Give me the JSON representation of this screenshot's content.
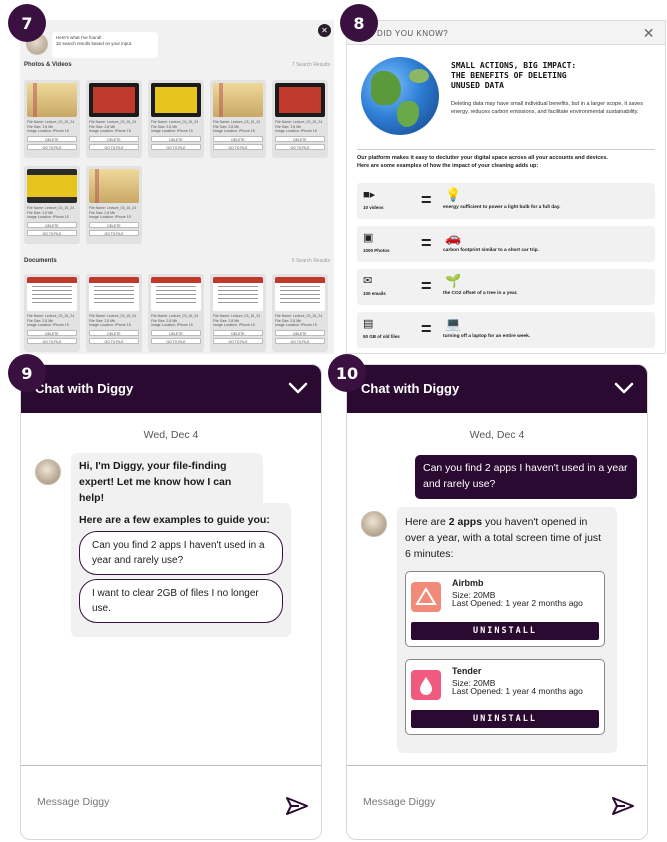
{
  "badges": {
    "b7": "7",
    "b8": "8",
    "b9": "9",
    "b10": "10"
  },
  "search_panel": {
    "message_line1": "Here's what I've found!",
    "message_line2": "32 search results based on your input.",
    "photos_title": "Photos & Videos",
    "photos_count": "7 Search Results",
    "documents_title": "Documents",
    "documents_count": "5 Search Results",
    "photo_cards": [
      {
        "thumb": "notes",
        "name": "File Name: Lecture_03_15_24",
        "size": "File Size: 2.8 Mb",
        "loc": "Image Location: iPhone 15",
        "b1": "DELETE",
        "b2": "GO TO FILE"
      },
      {
        "thumb": "screen red",
        "name": "File Name: Lecture_03_15_24",
        "size": "File Size: 2.8 Mb",
        "loc": "Image Location: iPhone 15",
        "b1": "DELETE",
        "b2": "GO TO FILE"
      },
      {
        "thumb": "screen yellow",
        "name": "File Name: Lecture_03_15_24",
        "size": "File Size: 2.8 Mb",
        "loc": "Image Location: iPhone 15",
        "b1": "DELETE",
        "b2": "GO TO FILE"
      },
      {
        "thumb": "notes",
        "name": "File Name: Lecture_03_15_24",
        "size": "File Size: 2.8 Mb",
        "loc": "Image Location: iPhone 15",
        "b1": "DELETE",
        "b2": "GO TO FILE"
      },
      {
        "thumb": "screen red",
        "name": "File Name: Lecture_03_15_24",
        "size": "File Size: 2.8 Mb",
        "loc": "Image Location: iPhone 15",
        "b1": "DELETE",
        "b2": "GO TO FILE"
      },
      {
        "thumb": "yellowbig",
        "name": "File Name: Lecture_03_15_24",
        "size": "File Size: 2.8 Mb",
        "loc": "Image Location: iPhone 15",
        "b1": "DELETE",
        "b2": "GO TO FILE"
      },
      {
        "thumb": "notes",
        "name": "File Name: Lecture_03_15_24",
        "size": "File Size: 2.8 Mb",
        "loc": "Image Location: iPhone 15",
        "b1": "DELETE",
        "b2": "GO TO FILE"
      }
    ],
    "doc_cards": [
      {
        "thumb": "doc",
        "name": "File Name: Lecture_03_15_24",
        "size": "File Size: 2.8 Mb",
        "loc": "Image Location: iPhone 15",
        "b1": "DELETE",
        "b2": "GO TO FILE"
      },
      {
        "thumb": "doc",
        "name": "File Name: Lecture_03_15_24",
        "size": "File Size: 2.8 Mb",
        "loc": "Image Location: iPhone 15",
        "b1": "DELETE",
        "b2": "GO TO FILE"
      },
      {
        "thumb": "doc",
        "name": "File Name: Lecture_03_15_24",
        "size": "File Size: 2.8 Mb",
        "loc": "Image Location: iPhone 15",
        "b1": "DELETE",
        "b2": "GO TO FILE"
      },
      {
        "thumb": "doc",
        "name": "File Name: Lecture_03_15_24",
        "size": "File Size: 2.8 Mb",
        "loc": "Image Location: iPhone 15",
        "b1": "DELETE",
        "b2": "GO TO FILE"
      },
      {
        "thumb": "doc",
        "name": "File Name: Lecture_03_15_24",
        "size": "File Size: 2.8 Mb",
        "loc": "Image Location: iPhone 15",
        "b1": "DELETE",
        "b2": "GO TO FILE"
      }
    ]
  },
  "did_you_know": {
    "header": "DID YOU KNOW?",
    "title_line1": "SMALL ACTIONS, BIG IMPACT:",
    "title_line2": "THE BENEFITS OF DELETING",
    "title_line3": "UNUSED DATA",
    "body": "Deleting data may have small individual benefits, but in a larger scope, it saves energy, reduces carbon emissions, and facilitate environmental sustainability.",
    "intro_line1": "Our platform makes it easy to declutter your digital space across all your accounts and devices.",
    "intro_line2": "Here are some examples of how the impact of your cleaning adds up:",
    "rows": [
      {
        "icon": "video-camera-icon",
        "label": "10 videos",
        "result_icon": "light-bulb-icon",
        "result": "energy sufficient to power a light bulb for a full day."
      },
      {
        "icon": "photo-icon",
        "label": "1000 Photos",
        "result_icon": "car-icon",
        "result": "carbon footprint similar to a short car trip."
      },
      {
        "icon": "envelope-icon",
        "label": "100 emails",
        "result_icon": "plant-icon",
        "result": "the CO2 offset of a tree in a year."
      },
      {
        "icon": "file-icon",
        "label": "50 GB of old files",
        "result_icon": "laptop-icon",
        "result": "turning off a laptop for an entire week."
      }
    ],
    "equals": "="
  },
  "chat_left": {
    "title": "Chat with Diggy",
    "date": "Wed, Dec 4",
    "greeting": "Hi, I'm Diggy, your file-finding expert! Let me know how I can help!",
    "examples_title": "Here are a few examples to guide you:",
    "example1": "Can you find 2 apps I haven't used in a year and rarely use?",
    "example2": "I want to clear 2GB of files I no longer use.",
    "input_placeholder": "Message Diggy"
  },
  "chat_right": {
    "title": "Chat with Diggy",
    "date": "Wed, Dec 4",
    "user_message": "Can you find 2 apps I haven't used in a year and rarely use?",
    "reply_pre": "Here are ",
    "reply_bold": "2 apps",
    "reply_post": " you haven't opened in over a year, with a total screen time of just 6 minutes:",
    "apps": [
      {
        "name": "Airbmb",
        "size": "Size: 20MB",
        "last": "Last Opened: 1 year 2 months ago",
        "button": "UNINSTALL",
        "color": "#f28a7a"
      },
      {
        "name": "Tender",
        "size": "Size: 20MB",
        "last": "Last Opened: 1 year 4 months ago",
        "button": "UNINSTALL",
        "color": "#f05a7e"
      }
    ],
    "input_placeholder": "Message Diggy"
  },
  "colors": {
    "accent": "#2b0a31",
    "badge": "#3a1040"
  }
}
